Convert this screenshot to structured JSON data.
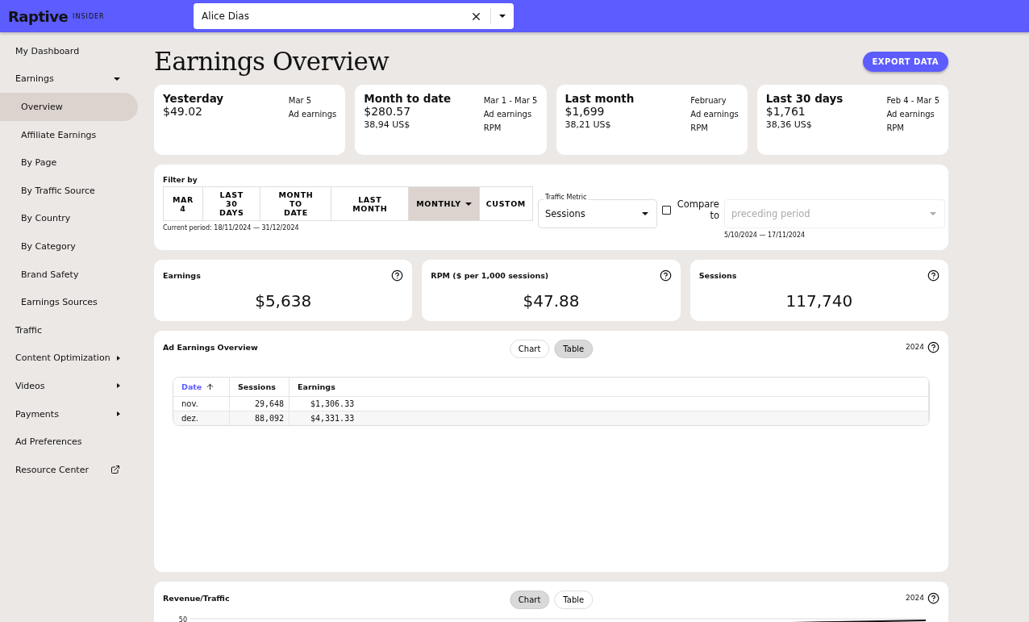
{
  "topbar": {
    "logo": "Raptive",
    "logo_sub": "INSIDER",
    "site_select": {
      "value": "Alice Dias"
    }
  },
  "sidebar": {
    "items": [
      {
        "label": "My Dashboard",
        "kind": "link"
      },
      {
        "label": "Earnings",
        "kind": "expandable",
        "expanded": true,
        "children": [
          {
            "label": "Overview",
            "selected": true
          },
          {
            "label": "Affiliate Earnings",
            "selected": false
          },
          {
            "label": "By Page",
            "selected": false
          },
          {
            "label": "By Traffic Source",
            "selected": false
          },
          {
            "label": "By Country",
            "selected": false
          },
          {
            "label": "By Category",
            "selected": false
          },
          {
            "label": "Brand Safety",
            "selected": false
          },
          {
            "label": "Earnings Sources",
            "selected": false
          }
        ]
      },
      {
        "label": "Traffic",
        "kind": "link"
      },
      {
        "label": "Content Optimization",
        "kind": "expandable",
        "expanded": false
      },
      {
        "label": "Videos",
        "kind": "expandable",
        "expanded": false
      },
      {
        "label": "Payments",
        "kind": "expandable",
        "expanded": false
      },
      {
        "label": "Ad Preferences",
        "kind": "link"
      },
      {
        "label": "Resource Center",
        "kind": "external"
      }
    ]
  },
  "page": {
    "title": "Earnings Overview",
    "export_button": "EXPORT DATA"
  },
  "summary_cards": [
    {
      "title": "Yesterday",
      "amount": "$49.02",
      "date": "Mar 5",
      "label": "Ad earnings"
    },
    {
      "title": "Month to date",
      "amount": "$280.57",
      "rpm": "38,94 US$",
      "date": "Mar 1 - Mar 5",
      "label": "Ad earnings",
      "rpm_label": "RPM"
    },
    {
      "title": "Last month",
      "amount": "$1,699",
      "rpm": "38,21 US$",
      "date": "February",
      "label": "Ad earnings",
      "rpm_label": "RPM"
    },
    {
      "title": "Last 30 days",
      "amount": "$1,761",
      "rpm": "38,36 US$",
      "date": "Feb 4 - Mar 5",
      "label": "Ad earnings",
      "rpm_label": "RPM"
    }
  ],
  "filter": {
    "label": "Filter by",
    "periods": [
      {
        "label": "MAR 4",
        "selected": false
      },
      {
        "label": "LAST 30 DAYS",
        "selected": false
      },
      {
        "label": "MONTH TO DATE",
        "selected": false
      },
      {
        "label": "LAST MONTH",
        "selected": false
      },
      {
        "label": "MONTHLY",
        "selected": true,
        "dropdown": true
      },
      {
        "label": "CUSTOM",
        "selected": false
      }
    ],
    "current_period": "Current period: 18/11/2024 — 31/12/2024",
    "traffic_metric": {
      "label": "Traffic Metric",
      "value": "Sessions"
    },
    "compare": {
      "label": "Compare to",
      "checked": false,
      "placeholder": "preceding period",
      "range": "5/10/2024 — 17/11/2024"
    }
  },
  "metrics": [
    {
      "label": "Earnings",
      "value": "$5,638"
    },
    {
      "label": "RPM ($ per 1,000 sessions)",
      "value": "$47.88"
    },
    {
      "label": "Sessions",
      "value": "117,740"
    }
  ],
  "ad_earnings": {
    "title": "Ad Earnings Overview",
    "toggle": [
      {
        "label": "Chart",
        "selected": false
      },
      {
        "label": "Table",
        "selected": true
      }
    ],
    "year": "2024",
    "table": {
      "columns": [
        "Date",
        "Sessions",
        "Earnings"
      ],
      "rows": [
        [
          "nov.",
          "29,648",
          "$1,306.33"
        ],
        [
          "dez.",
          "88,092",
          "$4,331.33"
        ]
      ]
    }
  },
  "revenue_traffic": {
    "title": "Revenue/Traffic",
    "toggle": [
      {
        "label": "Chart",
        "selected": true
      },
      {
        "label": "Table",
        "selected": false
      }
    ],
    "year": "2024",
    "y_tick": "50"
  }
}
